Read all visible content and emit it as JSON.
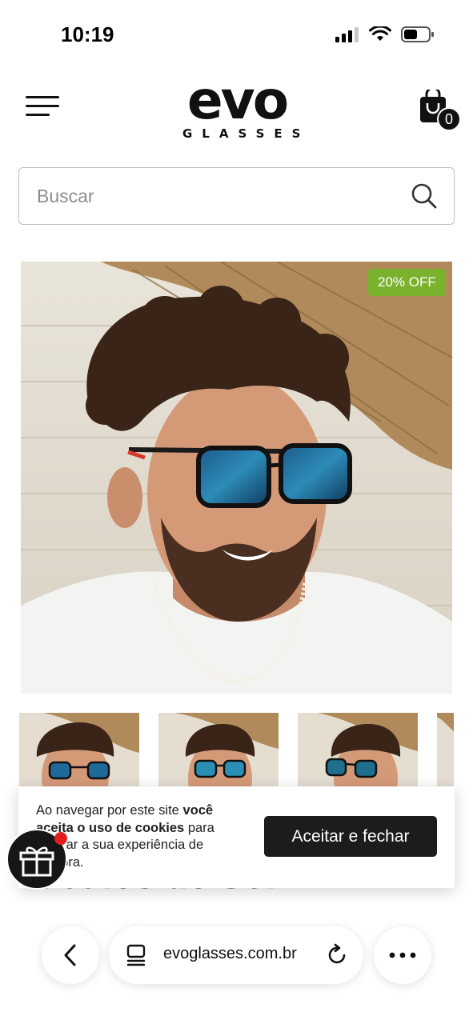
{
  "status_bar": {
    "time": "10:19"
  },
  "header": {
    "logo_main": "evo",
    "logo_sub": "GLASSES",
    "cart_count": "0"
  },
  "search": {
    "placeholder": "Buscar"
  },
  "product": {
    "discount_badge": "20% OFF",
    "title_partial": "Óculos de Sol"
  },
  "cookie_banner": {
    "text_1": "Ao navegar por este site ",
    "text_bold": "você aceita o uso de cookies",
    "text_2": " para agilizar a sua experiência de compra.",
    "accept_label": "Aceitar e fechar"
  },
  "browser": {
    "url": "evoglasses.com.br"
  },
  "colors": {
    "badge": "#7ab22e",
    "accent_dark": "#1c1c1c",
    "notification": "#e11d1d"
  },
  "icons": [
    "menu-icon",
    "cart-icon",
    "search-icon",
    "gift-icon",
    "back-icon",
    "tabs-icon",
    "reload-icon",
    "more-icon"
  ]
}
